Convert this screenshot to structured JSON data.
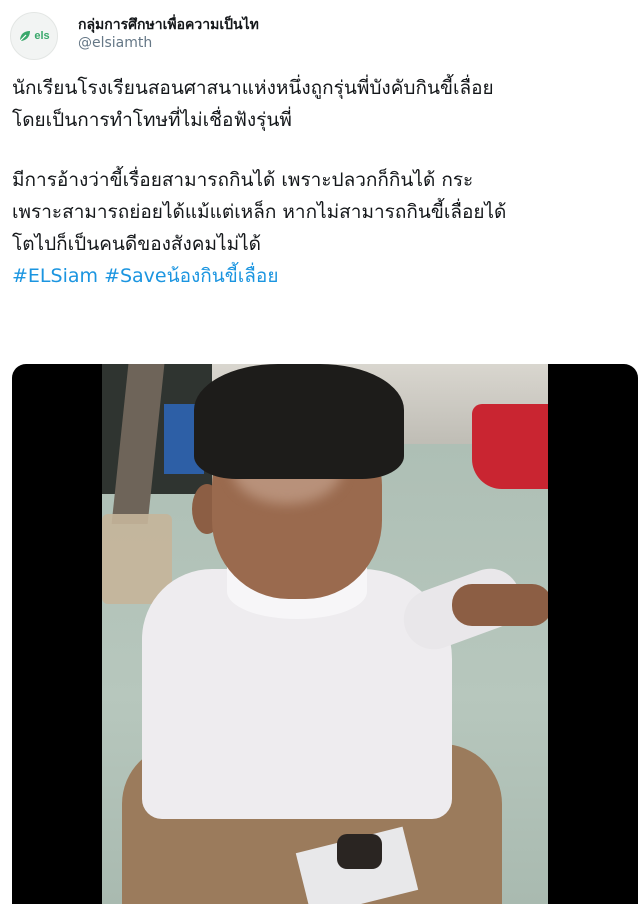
{
  "account": {
    "display_name": "กลุ่มการศึกษาเพื่อความเป็นไท",
    "handle": "@elsiamth",
    "avatar_text": "els",
    "avatar_color": "#39a86b"
  },
  "tweet": {
    "paragraph1": [
      "นักเรียนโรงเรียนสอนศาสนาแห่งหนึ่งถูกรุ่นพี่บังคับกินขี้เลื่อย",
      "โดยเป็นการทำโทษที่ไม่เชื่อฟังรุ่นพี่"
    ],
    "paragraph2": [
      "มีการอ้างว่าขี้เรื่อยสามารถกินได้ เพราะปลวกก็กินได้ กระ",
      "เพราะสามารถย่อยได้แม้แต่เหล็ก หากไม่สามารถกินขี้เลื่อยได้",
      "โตไปก็เป็นคนดีของสังคมไม่ได้"
    ],
    "hashtags": [
      "#ELSiam",
      "#Saveน้องกินขี้เลื่อย"
    ],
    "hashtag_color": "#1b95e0"
  },
  "media": {
    "type": "video-still"
  }
}
